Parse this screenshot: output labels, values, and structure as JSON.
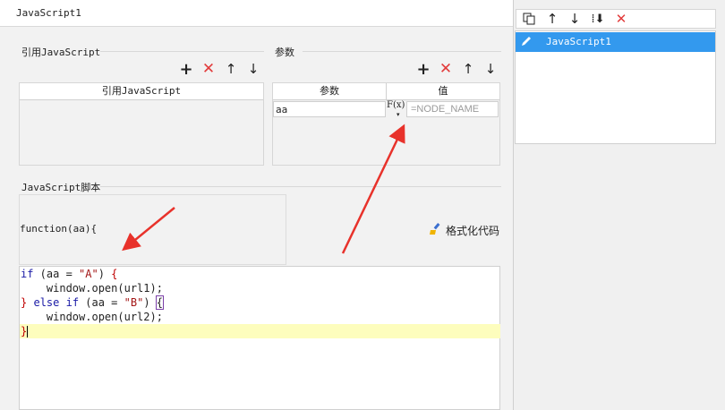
{
  "dialog": {
    "title": "JavaScript1"
  },
  "ref_js": {
    "section_label": "引用JavaScript",
    "column_header": "引用JavaScript",
    "toolbar": {
      "add": "+",
      "delete": "✕",
      "up": "↑",
      "down": "↓"
    }
  },
  "params": {
    "section_label": "参数",
    "columns": [
      "参数",
      "值"
    ],
    "rows": [
      {
        "name": "aa",
        "fx_label": "F(x)",
        "value_placeholder": "=NODE_NAME"
      }
    ],
    "toolbar": {
      "add": "+",
      "delete": "✕",
      "up": "↑",
      "down": "↓"
    }
  },
  "script": {
    "section_label": "JavaScript脚本",
    "function_signature": "function(aa){",
    "format_button_label": "格式化代码",
    "code_lines": [
      "if (aa = \"A\") {",
      "    window.open(url1);",
      "} else if (aa = \"B\") {",
      "    window.open(url2);",
      "}"
    ]
  },
  "right_panel": {
    "items": [
      {
        "label": "JavaScript1",
        "selected": true
      }
    ]
  },
  "colors": {
    "selection": "#3399ee",
    "delete_icon": "#e23b3b",
    "annotation_arrow": "#e8322b",
    "active_line": "#fdfdbd"
  }
}
